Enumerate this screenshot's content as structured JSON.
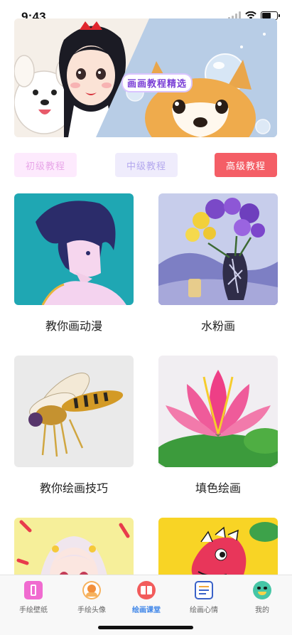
{
  "status": {
    "time": "9:43"
  },
  "banner": {
    "title": "画画教程精选"
  },
  "levels": [
    "初级教程",
    "中级教程",
    "高级教程"
  ],
  "courses": [
    {
      "label": "教你画动漫",
      "image": "anime-boy-illustration"
    },
    {
      "label": "水粉画",
      "image": "gouache-flowers-vase"
    },
    {
      "label": "教你绘画技巧",
      "image": "hoverfly-drawing"
    },
    {
      "label": "填色绘画",
      "image": "lotus-coloring"
    },
    {
      "label": "",
      "image": "anime-girl-illustration"
    },
    {
      "label": "",
      "image": "dinosaur-coloring"
    }
  ],
  "nav": [
    {
      "label": "手绘壁纸",
      "icon": "wallpaper-icon"
    },
    {
      "label": "手绘头像",
      "icon": "avatar-icon"
    },
    {
      "label": "绘画课堂",
      "icon": "classroom-icon"
    },
    {
      "label": "绘画心情",
      "icon": "notebook-icon"
    },
    {
      "label": "我的",
      "icon": "smiley-face-icon"
    }
  ],
  "colors": {
    "accent": "#f45e66",
    "nav_active": "#3f86e8"
  }
}
